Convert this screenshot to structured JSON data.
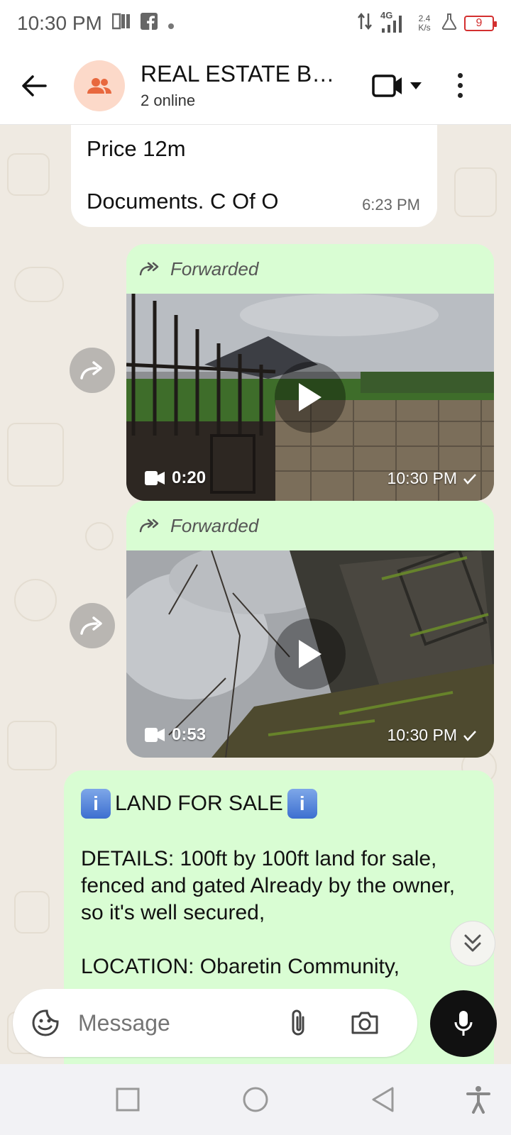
{
  "status_bar": {
    "time": "10:30 PM",
    "network_type": "4G",
    "net_speed_value": "2.4",
    "net_speed_unit": "K/s",
    "battery": "9",
    "icons": [
      "news-icon",
      "facebook-icon",
      "dot-icon",
      "data-arrows-icon",
      "signal-icon",
      "flask-icon",
      "battery-icon"
    ]
  },
  "header": {
    "title": "REAL ESTATE BU...",
    "subtitle": "2 online",
    "avatar_color": "#fcd9c9",
    "avatar_icon": "group-icon"
  },
  "messages": {
    "incoming": {
      "line1": "Price 12m",
      "line2": "Documents.  C Of O",
      "time": "6:23 PM"
    },
    "forwarded_videos": [
      {
        "label": "Forwarded",
        "duration": "0:20",
        "time": "10:30 PM"
      },
      {
        "label": "Forwarded",
        "duration": "0:53",
        "time": "10:30 PM"
      }
    ],
    "outgoing": {
      "title": "LAND FOR SALE",
      "info_glyph": "i",
      "details": "DETAILS: 100ft by 100ft land for sale, fenced and gated Already by the owner,  so it's well secured,",
      "location": "LOCATION: Obaretin Community,"
    }
  },
  "composer": {
    "placeholder": "Message"
  },
  "colors": {
    "chat_background": "#efeae2",
    "outgoing_bubble": "#d9fdd3",
    "incoming_bubble": "#ffffff",
    "mic_button": "#111111",
    "battery_low": "#d32f2f"
  }
}
